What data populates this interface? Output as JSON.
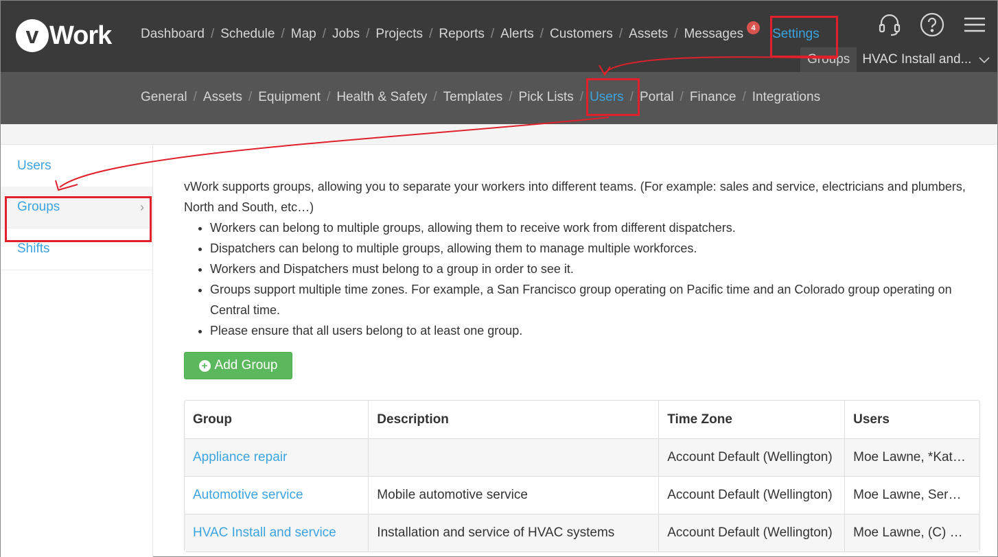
{
  "header": {
    "logo_v": "v",
    "logo_text": "Work",
    "nav": [
      "Dashboard",
      "Schedule",
      "Map",
      "Jobs",
      "Projects",
      "Reports",
      "Alerts",
      "Customers",
      "Assets",
      "Messages",
      "Settings"
    ],
    "messages_badge": "4",
    "group_label": "Groups",
    "group_value": "HVAC Install and...",
    "icons": [
      "headset-icon",
      "help-icon",
      "menu-icon"
    ]
  },
  "subnav": [
    "General",
    "Assets",
    "Equipment",
    "Health & Safety",
    "Templates",
    "Pick Lists",
    "Users",
    "Portal",
    "Finance",
    "Integrations"
  ],
  "sidebar": {
    "items": [
      {
        "label": "Users"
      },
      {
        "label": "Groups"
      },
      {
        "label": "Shifts"
      }
    ]
  },
  "main": {
    "intro": "vWork supports groups, allowing you to separate your workers into different teams. (For example: sales and service, electricians and plumbers, North and South, etc…)",
    "bullets": [
      "Workers can belong to multiple groups, allowing them to receive work from different dispatchers.",
      "Dispatchers can belong to multiple groups, allowing them to manage multiple workforces.",
      "Workers and Dispatchers must belong to a group in order to see it.",
      "Groups support multiple time zones. For example, a San Francisco group operating on Pacific time and an Colorado group operating on Central time.",
      "Please ensure that all users belong to at least one group."
    ],
    "add_button": "Add Group"
  },
  "table": {
    "headers": [
      "Group",
      "Description",
      "Time Zone",
      "Users"
    ],
    "rows": [
      [
        "Appliance repair",
        "",
        "Account Default (Wellington)",
        "Moe Lawne, *Kat…"
      ],
      [
        "Automotive service",
        "Mobile automotive service",
        "Account Default (Wellington)",
        "Moe Lawne, Ser…"
      ],
      [
        "HVAC Install and service",
        "Installation and service of HVAC systems",
        "Account Default (Wellington)",
        "Moe Lawne, (C) …"
      ]
    ]
  },
  "colors": {
    "accent": "#3ba4e0",
    "annotation": "#e0202a",
    "button_green": "#5cb85c"
  }
}
